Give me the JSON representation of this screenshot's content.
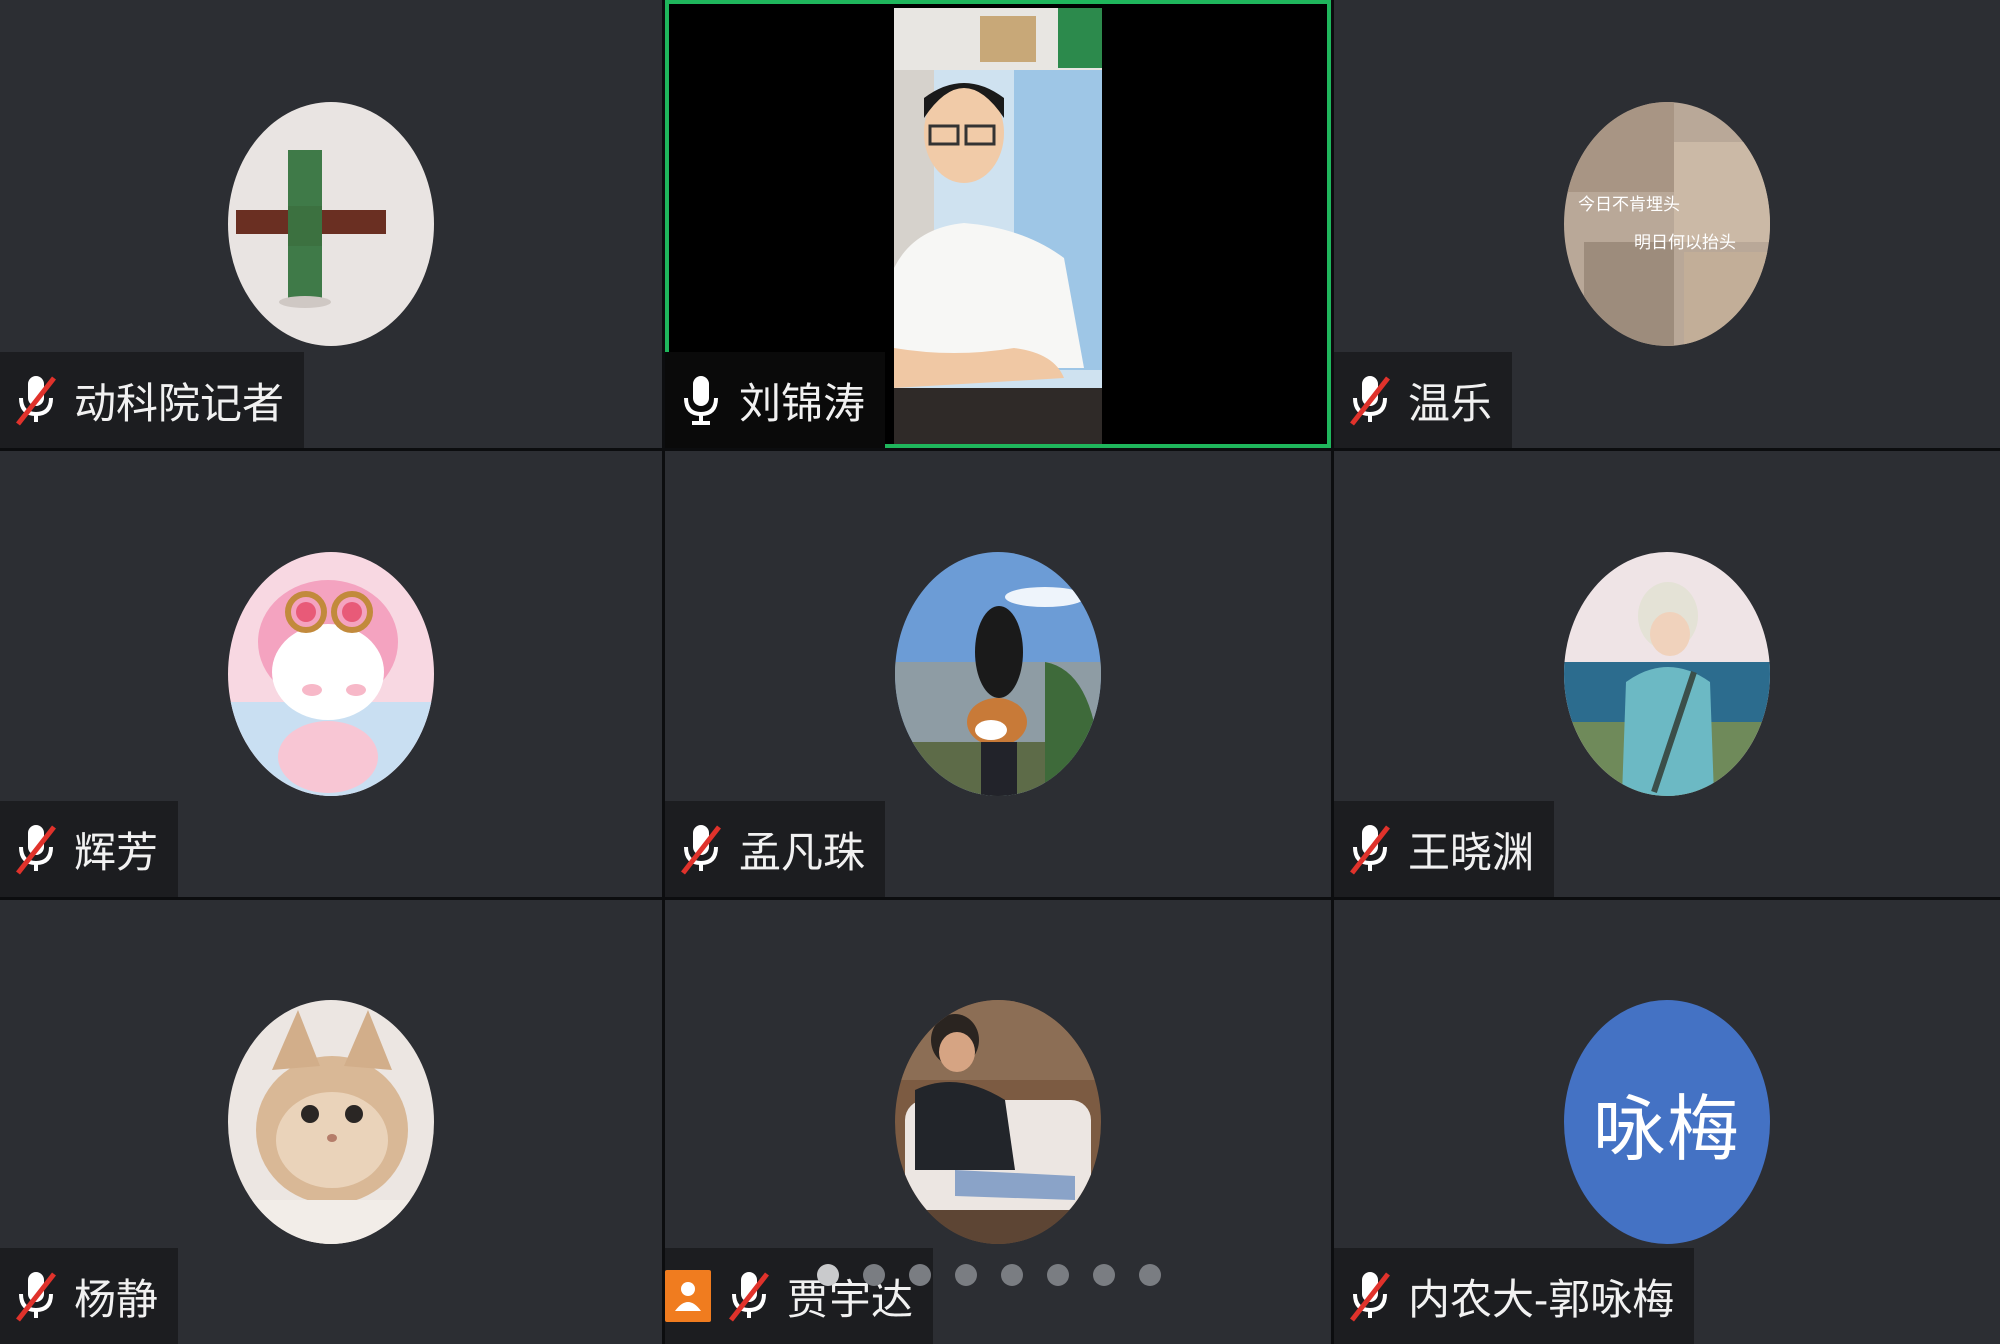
{
  "meeting": {
    "participants": [
      {
        "name": "动科院记者",
        "muted": true,
        "avatar": "lego-cross-icon"
      },
      {
        "name": "刘锦涛",
        "muted": false,
        "speaking": true,
        "avatar": "live-video"
      },
      {
        "name": "温乐",
        "muted": true,
        "avatar": "collage-text-icon",
        "avatar_text_1": "今日不肯埋头",
        "avatar_text_2": "明日何以抬头"
      },
      {
        "name": "辉芳",
        "muted": true,
        "avatar": "pink-bunny-cartoon-icon"
      },
      {
        "name": "孟凡珠",
        "muted": true,
        "avatar": "girl-with-dog-icon"
      },
      {
        "name": "王晓渊",
        "muted": true,
        "avatar": "illustrated-person-sea-icon"
      },
      {
        "name": "杨静",
        "muted": true,
        "avatar": "cat-photo-icon"
      },
      {
        "name": "贾宇达",
        "muted": true,
        "host": true,
        "avatar": "man-on-sofa-icon"
      },
      {
        "name": "内农大-郭咏梅",
        "muted": true,
        "avatar_initials": "咏梅",
        "avatar_color": "#4472c4"
      }
    ],
    "page_indicator": {
      "count": 8,
      "current": 0
    },
    "colors": {
      "tile_bg": "#2c2e33",
      "active_border": "#1fb65c",
      "muted_slash": "#e0322b",
      "host_badge": "#f07c1f"
    }
  }
}
